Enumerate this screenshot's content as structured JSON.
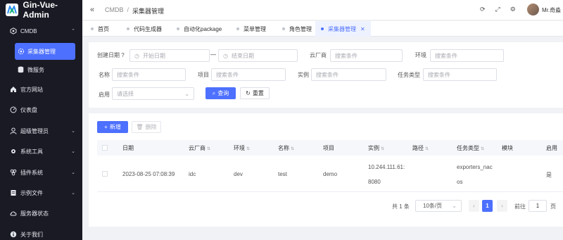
{
  "app": {
    "title": "Gin-Vue-Admin"
  },
  "sidebar": {
    "cmdb_label": "CMDB",
    "active_sub": "采集器管理",
    "items": [
      {
        "label": "微服务"
      },
      {
        "label": "官方网站"
      },
      {
        "label": "仪表盘"
      },
      {
        "label": "超级管理员"
      },
      {
        "label": "系统工具"
      },
      {
        "label": "插件系统"
      },
      {
        "label": "示例文件"
      },
      {
        "label": "服务器状态"
      },
      {
        "label": "关于我们"
      }
    ]
  },
  "header": {
    "breadcrumb_root": "CMDB",
    "breadcrumb_sep": "/",
    "breadcrumb_current": "采集器管理",
    "username": "Mr.奇淼"
  },
  "tabs": [
    {
      "label": "首页"
    },
    {
      "label": "代码生成器"
    },
    {
      "label": "自动化package"
    },
    {
      "label": "菜单管理"
    },
    {
      "label": "角色管理"
    },
    {
      "label": "采集器管理"
    }
  ],
  "search": {
    "created_date_label": "创建日期",
    "start_placeholder": "开始日期",
    "range_sep": "—",
    "end_placeholder": "结束日期",
    "cloud_label": "云厂商",
    "cloud_placeholder": "搜索条件",
    "env_label": "环境",
    "env_placeholder": "搜索条件",
    "name_label": "名称",
    "name_placeholder": "搜索条件",
    "project_label": "项目",
    "project_placeholder": "搜索条件",
    "instance_label": "实例",
    "instance_placeholder": "搜索条件",
    "tasktype_label": "任务类型",
    "tasktype_placeholder": "搜索条件",
    "enable_label": "启用",
    "enable_placeholder": "请选择",
    "query_button": "查询",
    "reset_button": "重置"
  },
  "toolbar": {
    "add_button": "新增",
    "delete_button": "删除"
  },
  "table": {
    "columns": [
      "日期",
      "云厂商",
      "环境",
      "名称",
      "项目",
      "实例",
      "路径",
      "任务类型",
      "模块",
      "启用"
    ],
    "rows": [
      {
        "date": "2023-08-25 07:08:39",
        "cloud": "idc",
        "env": "dev",
        "name": "test",
        "project": "demo",
        "instance_line1": "10.244.111.61:",
        "instance_line2": "8080",
        "path": "",
        "tasktype_line1": "exporters_nac",
        "tasktype_line2": "os",
        "module": "",
        "enabled": "是"
      }
    ]
  },
  "pagination": {
    "total_text": "共 1 条",
    "page_size": "10条/页",
    "prev": "‹",
    "current_page": "1",
    "next": "›",
    "goto_label": "前往",
    "goto_value": "1",
    "page_unit": "页"
  },
  "colors": {
    "primary": "#4d70ff",
    "sidebar_bg": "#191a23"
  }
}
